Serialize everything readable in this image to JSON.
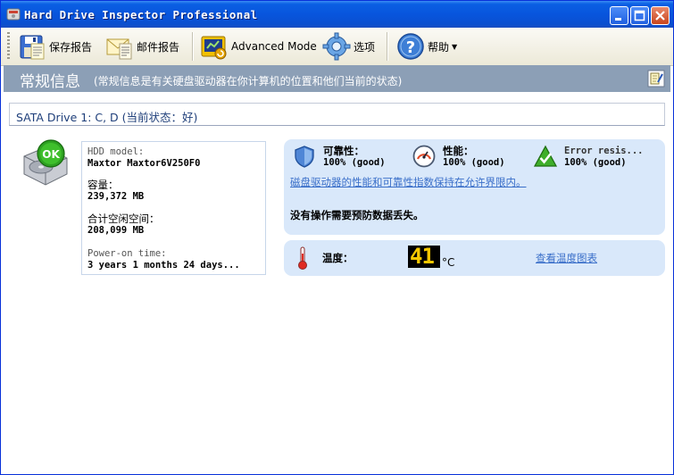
{
  "window": {
    "title": "Hard Drive Inspector Professional"
  },
  "toolbar": {
    "save_report": "保存报告",
    "mail_report": "邮件报告",
    "advanced_mode": "Advanced Mode",
    "options": "选项",
    "help": "帮助"
  },
  "header": {
    "title": "常规信息",
    "subtitle": "(常规信息是有关硬盘驱动器在你计算机的位置和他们当前的状态)"
  },
  "drive": {
    "line": "SATA Drive 1: C, D (当前状态：好)",
    "status_badge": "OK"
  },
  "info": {
    "model_label": "HDD model:",
    "model_value": "Maxtor Maxtor6V250F0",
    "capacity_label": "容量：",
    "capacity_value": "239,372 MB",
    "free_label": "合计空闲空间：",
    "free_value": "208,099 MB",
    "power_label": "Power-on time:",
    "power_value": "3 years 1 months 24 days..."
  },
  "status": {
    "reliability_label": "可靠性：",
    "reliability_value": "100% (good)",
    "performance_label": "性能：",
    "performance_value": "100% (good)",
    "error_label": "Error resis...",
    "error_value": "100% (good)",
    "link_text": "磁盘驱动器的性能和可靠性指数保持在允许界限内。",
    "note": "没有操作需要预防数据丢失。"
  },
  "temperature": {
    "label": "温度：",
    "value": "41",
    "unit": "°C",
    "chart_link": "查看温度图表"
  },
  "colors": {
    "titlebar": "#0855dd",
    "header": "#8c9fb6",
    "panel": "#d9e8fa",
    "link": "#3a6fc9"
  }
}
